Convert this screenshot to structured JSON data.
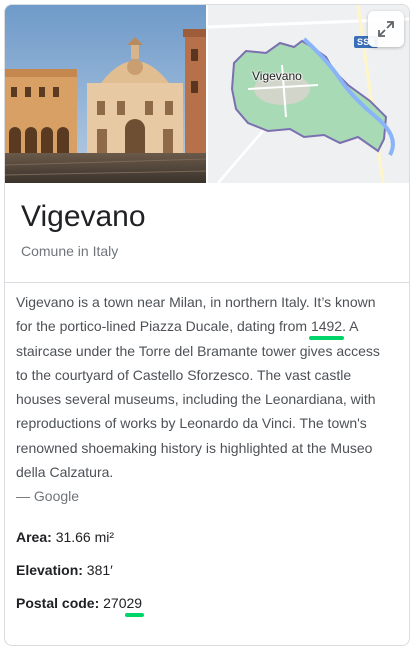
{
  "place": {
    "name": "Vigevano",
    "type": "Comune in Italy"
  },
  "map": {
    "city_label": "Vigevano",
    "road_badge": "SS5",
    "expand_icon": "expand-arrows-icon"
  },
  "description": {
    "text_before": "Vigevano is a town near Milan, in northern Italy. It’s known for the portico-lined Piazza Ducale, dating from ",
    "highlight": "1492",
    "text_after": ". A staircase under the Torre del Bramante tower gives access to the courtyard of Castello Sforzesco. The vast castle houses several museums, including the Leonardiana, with reproductions of works by Leonardo da Vinci. The town's renowned shoemaking history is highlighted at the Museo della Calzatura.",
    "source": "— Google"
  },
  "facts": {
    "area_label": "Area:",
    "area_value": "31.66 mi²",
    "elevation_label": "Elevation:",
    "elevation_value": "381′",
    "postal_label": "Postal code:",
    "postal_value_plain": "270",
    "postal_value_highlight": "29"
  },
  "colors": {
    "highlight": "#00d56a",
    "map_region": "#a8dab5",
    "map_border": "#7b6fb0",
    "road_badge": "#3a6fb8"
  }
}
